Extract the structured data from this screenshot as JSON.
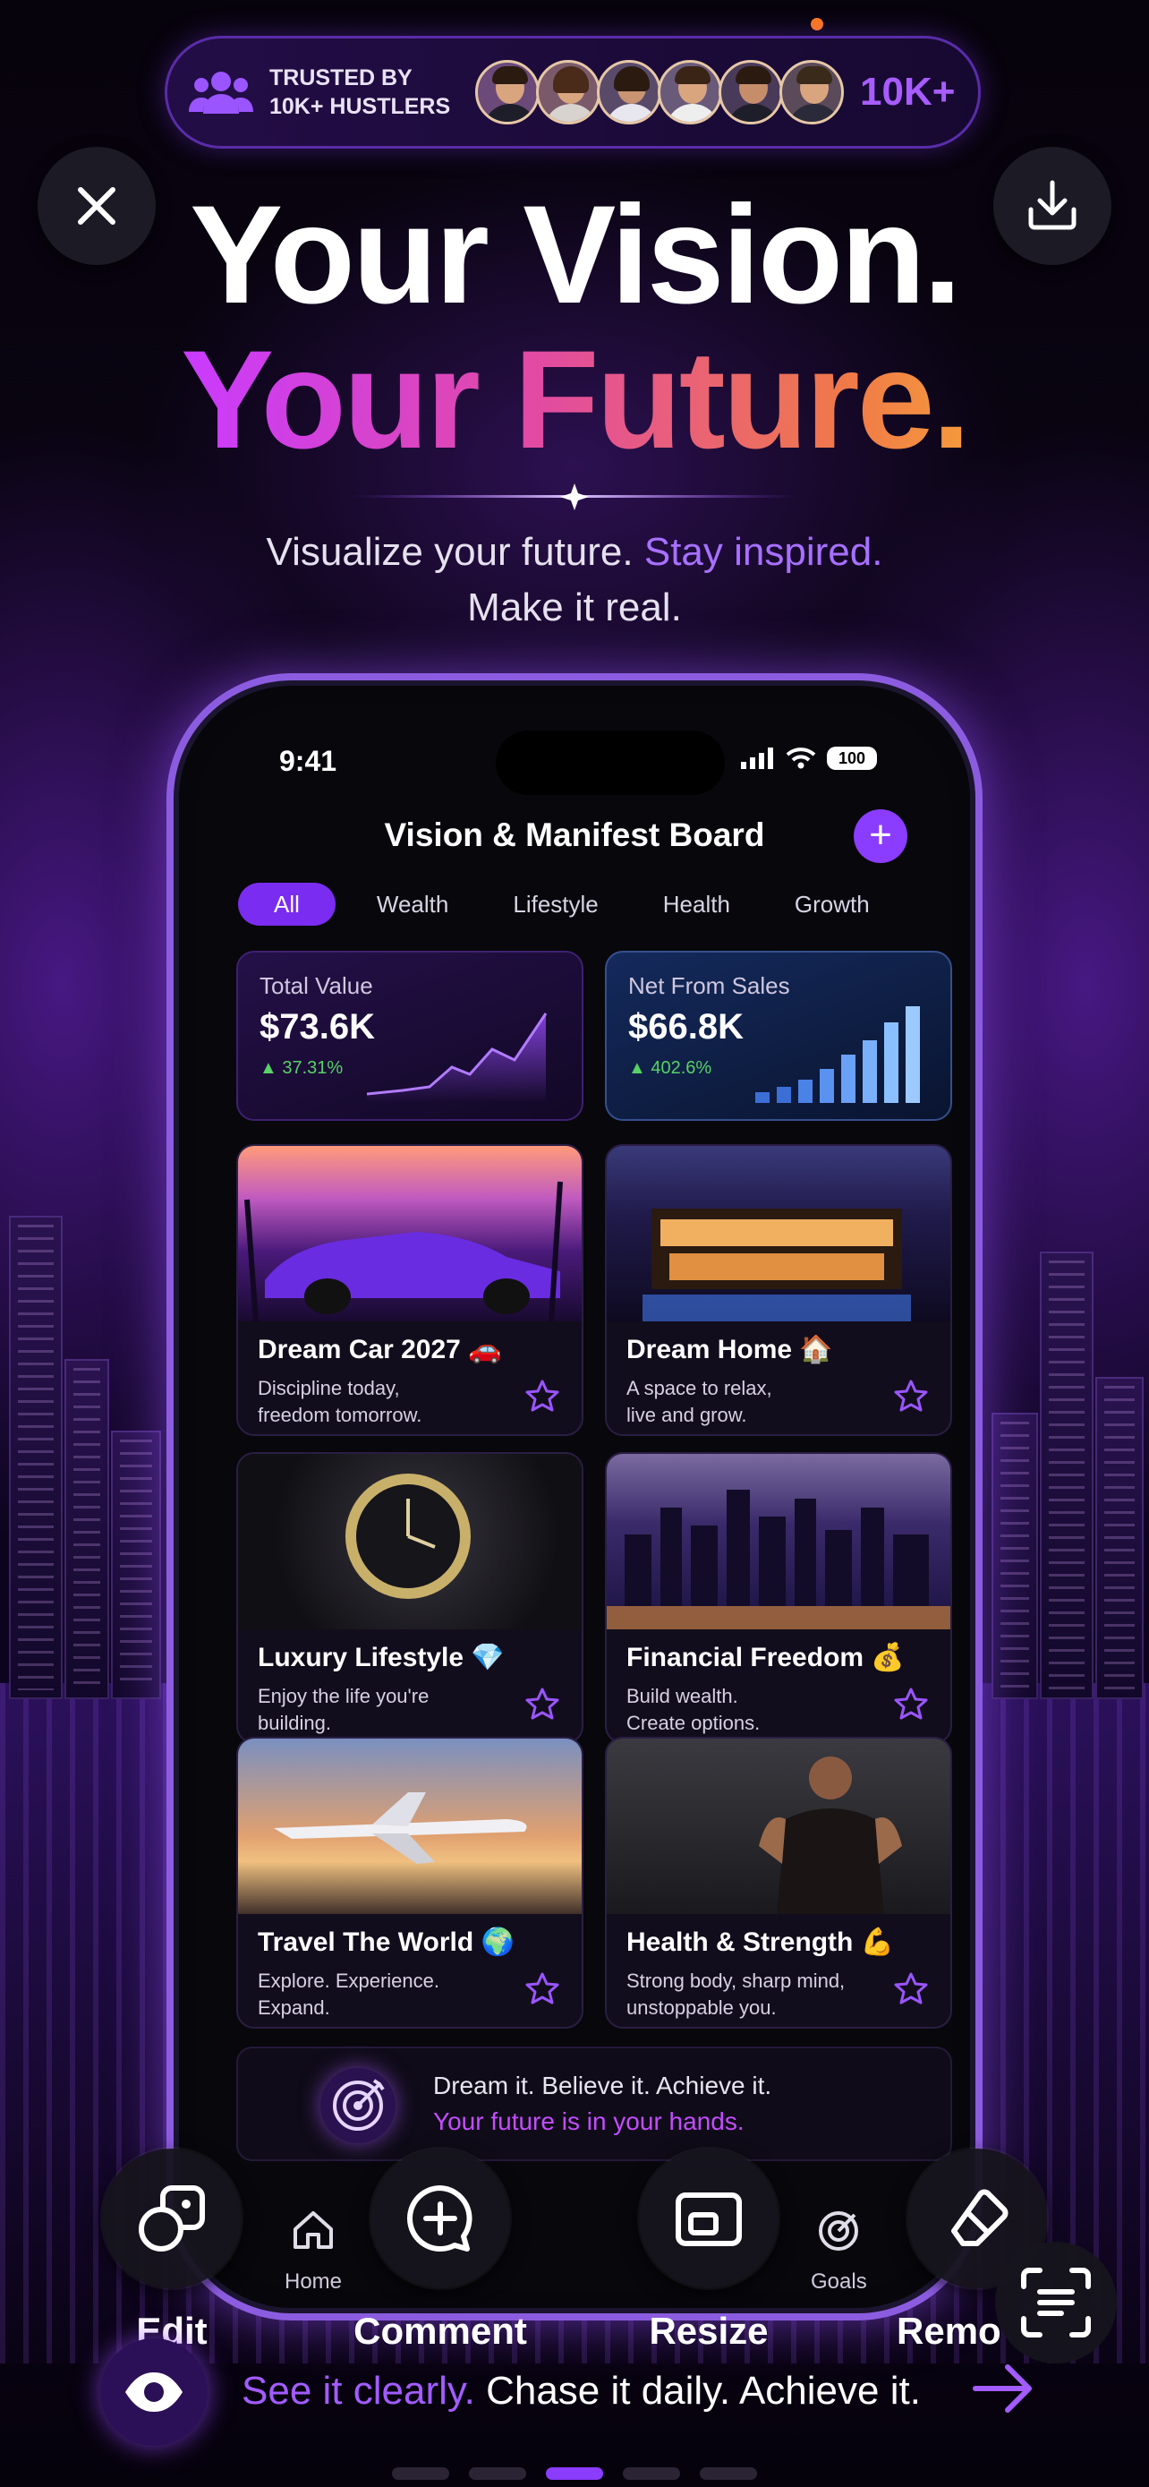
{
  "trust": {
    "line1": "TRUSTED BY",
    "line2": "10K+ HUSTLERS",
    "count": "10K+"
  },
  "hero": {
    "line1": "Your Vision.",
    "line2": "Your Future.",
    "sub_a": "Visualize your future.",
    "sub_b": "Stay inspired.",
    "sub_c": "Make it real."
  },
  "phone": {
    "time": "9:41",
    "battery": "100",
    "title": "Vision & Manifest Board",
    "plus": "+",
    "filters": [
      "All",
      "Wealth",
      "Lifestyle",
      "Health",
      "Growth"
    ],
    "stats": [
      {
        "label": "Total Value",
        "value": "$73.6K",
        "change": "▲ 37.31%"
      },
      {
        "label": "Net From Sales",
        "value": "$66.8K",
        "change": "▲ 402.6%"
      }
    ],
    "cards": [
      {
        "title": "Dream Car 2027 🚗",
        "desc1": "Discipline today,",
        "desc2": "freedom tomorrow."
      },
      {
        "title": "Dream Home 🏠",
        "desc1": "A space to relax,",
        "desc2": "live and grow."
      },
      {
        "title": "Luxury Lifestyle 💎",
        "desc1": "Enjoy the life you're",
        "desc2": "building."
      },
      {
        "title": "Financial Freedom 💰",
        "desc1": "Build wealth.",
        "desc2": "Create options."
      },
      {
        "title": "Travel The World 🌍",
        "desc1": "Explore. Experience.",
        "desc2": "Expand."
      },
      {
        "title": "Health & Strength 💪",
        "desc1": "Strong body, sharp mind,",
        "desc2": "unstoppable you."
      }
    ],
    "quote1": "Dream it. Believe it. Achieve it.",
    "quote2": "Your future is in your hands.",
    "tabs": [
      "Home",
      "Goals"
    ]
  },
  "tools": [
    "Edit",
    "Comment",
    "Resize",
    "Remo"
  ],
  "tagline": {
    "accent": "See it clearly.",
    "rest": " Chase it daily. Achieve it."
  },
  "colors": {
    "accent": "#8a3cff",
    "pink": "#e24aa3",
    "orange": "#f59a3c",
    "green": "#57d266"
  }
}
